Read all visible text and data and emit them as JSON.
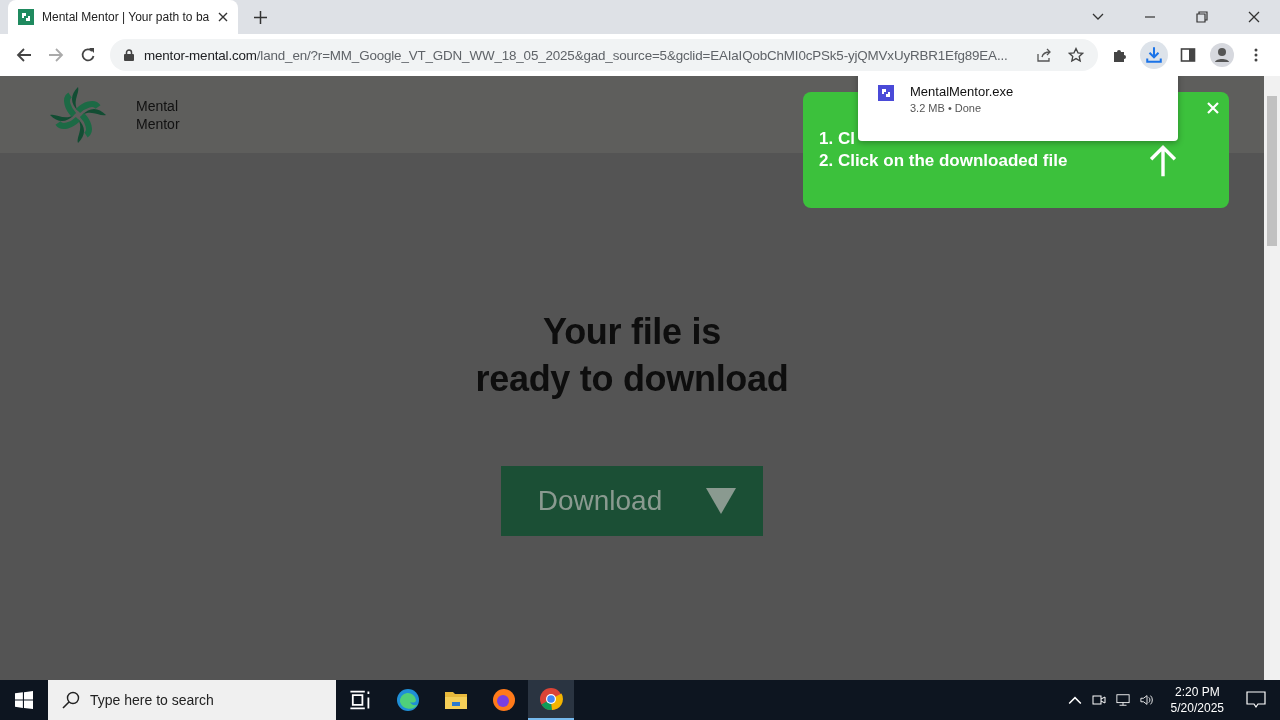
{
  "browser": {
    "tab_title": "Mental Mentor | Your path to ba",
    "address": {
      "domain": "mentor-mental.com",
      "path": "/land_en/?r=MM_Google_VT_GDN_WW_18_05_2025&gad_source=5&gclid=EAIaIQobChMI0cPSk5-yjQMVxUyRBR1Efg89EA..."
    }
  },
  "download_bubble": {
    "file": "MentalMentor.exe",
    "status": "3.2 MB • Done"
  },
  "page": {
    "brand": [
      "Mental",
      "Mentor"
    ],
    "headline": [
      "Your file is",
      "ready to download"
    ],
    "button": "Download"
  },
  "instructions": {
    "steps": [
      "1. Cl",
      "2. Click on the downloaded file"
    ]
  },
  "taskbar": {
    "search_placeholder": "Type here to search",
    "time": "2:20 PM",
    "date": "5/20/2025"
  }
}
